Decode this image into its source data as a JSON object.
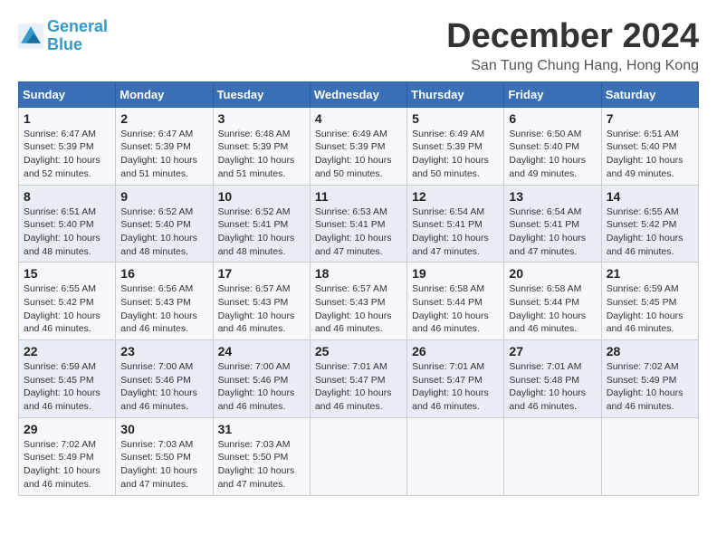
{
  "logo": {
    "line1": "General",
    "line2": "Blue"
  },
  "title": "December 2024",
  "location": "San Tung Chung Hang, Hong Kong",
  "headers": [
    "Sunday",
    "Monday",
    "Tuesday",
    "Wednesday",
    "Thursday",
    "Friday",
    "Saturday"
  ],
  "weeks": [
    [
      {
        "day": "1",
        "sunrise": "6:47 AM",
        "sunset": "5:39 PM",
        "daylight": "10 hours and 52 minutes."
      },
      {
        "day": "2",
        "sunrise": "6:47 AM",
        "sunset": "5:39 PM",
        "daylight": "10 hours and 51 minutes."
      },
      {
        "day": "3",
        "sunrise": "6:48 AM",
        "sunset": "5:39 PM",
        "daylight": "10 hours and 51 minutes."
      },
      {
        "day": "4",
        "sunrise": "6:49 AM",
        "sunset": "5:39 PM",
        "daylight": "10 hours and 50 minutes."
      },
      {
        "day": "5",
        "sunrise": "6:49 AM",
        "sunset": "5:39 PM",
        "daylight": "10 hours and 50 minutes."
      },
      {
        "day": "6",
        "sunrise": "6:50 AM",
        "sunset": "5:40 PM",
        "daylight": "10 hours and 49 minutes."
      },
      {
        "day": "7",
        "sunrise": "6:51 AM",
        "sunset": "5:40 PM",
        "daylight": "10 hours and 49 minutes."
      }
    ],
    [
      {
        "day": "8",
        "sunrise": "6:51 AM",
        "sunset": "5:40 PM",
        "daylight": "10 hours and 48 minutes."
      },
      {
        "day": "9",
        "sunrise": "6:52 AM",
        "sunset": "5:40 PM",
        "daylight": "10 hours and 48 minutes."
      },
      {
        "day": "10",
        "sunrise": "6:52 AM",
        "sunset": "5:41 PM",
        "daylight": "10 hours and 48 minutes."
      },
      {
        "day": "11",
        "sunrise": "6:53 AM",
        "sunset": "5:41 PM",
        "daylight": "10 hours and 47 minutes."
      },
      {
        "day": "12",
        "sunrise": "6:54 AM",
        "sunset": "5:41 PM",
        "daylight": "10 hours and 47 minutes."
      },
      {
        "day": "13",
        "sunrise": "6:54 AM",
        "sunset": "5:41 PM",
        "daylight": "10 hours and 47 minutes."
      },
      {
        "day": "14",
        "sunrise": "6:55 AM",
        "sunset": "5:42 PM",
        "daylight": "10 hours and 46 minutes."
      }
    ],
    [
      {
        "day": "15",
        "sunrise": "6:55 AM",
        "sunset": "5:42 PM",
        "daylight": "10 hours and 46 minutes."
      },
      {
        "day": "16",
        "sunrise": "6:56 AM",
        "sunset": "5:43 PM",
        "daylight": "10 hours and 46 minutes."
      },
      {
        "day": "17",
        "sunrise": "6:57 AM",
        "sunset": "5:43 PM",
        "daylight": "10 hours and 46 minutes."
      },
      {
        "day": "18",
        "sunrise": "6:57 AM",
        "sunset": "5:43 PM",
        "daylight": "10 hours and 46 minutes."
      },
      {
        "day": "19",
        "sunrise": "6:58 AM",
        "sunset": "5:44 PM",
        "daylight": "10 hours and 46 minutes."
      },
      {
        "day": "20",
        "sunrise": "6:58 AM",
        "sunset": "5:44 PM",
        "daylight": "10 hours and 46 minutes."
      },
      {
        "day": "21",
        "sunrise": "6:59 AM",
        "sunset": "5:45 PM",
        "daylight": "10 hours and 46 minutes."
      }
    ],
    [
      {
        "day": "22",
        "sunrise": "6:59 AM",
        "sunset": "5:45 PM",
        "daylight": "10 hours and 46 minutes."
      },
      {
        "day": "23",
        "sunrise": "7:00 AM",
        "sunset": "5:46 PM",
        "daylight": "10 hours and 46 minutes."
      },
      {
        "day": "24",
        "sunrise": "7:00 AM",
        "sunset": "5:46 PM",
        "daylight": "10 hours and 46 minutes."
      },
      {
        "day": "25",
        "sunrise": "7:01 AM",
        "sunset": "5:47 PM",
        "daylight": "10 hours and 46 minutes."
      },
      {
        "day": "26",
        "sunrise": "7:01 AM",
        "sunset": "5:47 PM",
        "daylight": "10 hours and 46 minutes."
      },
      {
        "day": "27",
        "sunrise": "7:01 AM",
        "sunset": "5:48 PM",
        "daylight": "10 hours and 46 minutes."
      },
      {
        "day": "28",
        "sunrise": "7:02 AM",
        "sunset": "5:49 PM",
        "daylight": "10 hours and 46 minutes."
      }
    ],
    [
      {
        "day": "29",
        "sunrise": "7:02 AM",
        "sunset": "5:49 PM",
        "daylight": "10 hours and 46 minutes."
      },
      {
        "day": "30",
        "sunrise": "7:03 AM",
        "sunset": "5:50 PM",
        "daylight": "10 hours and 47 minutes."
      },
      {
        "day": "31",
        "sunrise": "7:03 AM",
        "sunset": "5:50 PM",
        "daylight": "10 hours and 47 minutes."
      },
      null,
      null,
      null,
      null
    ]
  ]
}
